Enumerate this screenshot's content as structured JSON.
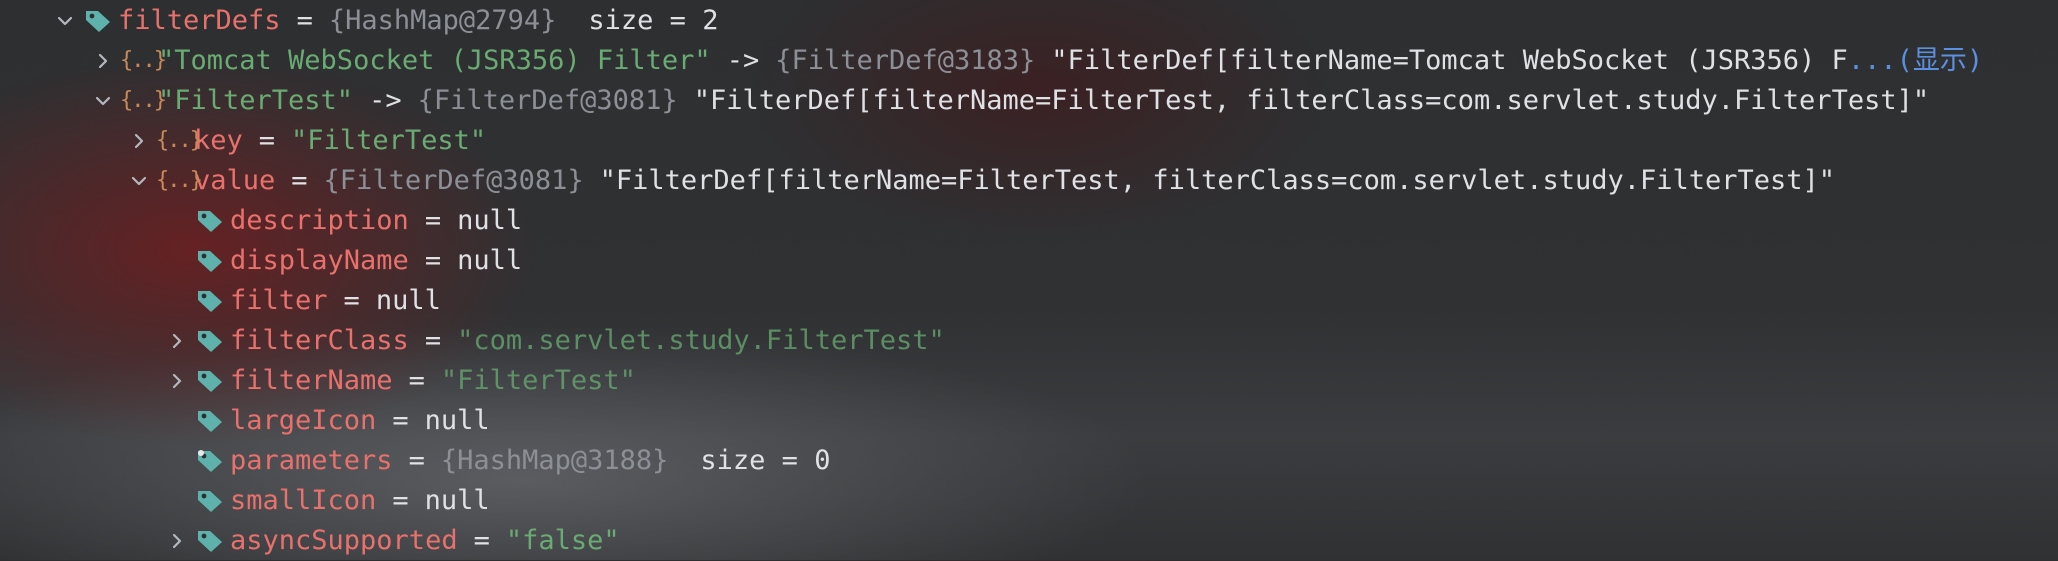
{
  "colors": {
    "field_name": "#e8716d",
    "string_value": "#6aab73",
    "object_ref": "#8c9096",
    "plain_text": "#dfe1e5",
    "tag_icon": "#5fb2ac",
    "object_icon": "#c68a58",
    "link": "#5b8fe0"
  },
  "rows": [
    {
      "name": "filterDefs",
      "eq": "=",
      "ref": "{HashMap@2794}",
      "extra": "size = 2",
      "icon": "tag-icon",
      "chevron": "expanded"
    },
    {
      "key": "\"Tomcat WebSocket (JSR356) Filter\"",
      "arrow": "->",
      "ref": "{FilterDef@3183}",
      "text": "\"FilterDef[filterName=Tomcat WebSocket (JSR356) F",
      "more": "...(显示)",
      "icon": "object-icon",
      "chevron": "collapsed"
    },
    {
      "key": "\"FilterTest\"",
      "arrow": "->",
      "ref": "{FilterDef@3081}",
      "text": "\"FilterDef[filterName=FilterTest, filterClass=com.servlet.study.FilterTest]\"",
      "icon": "object-icon",
      "chevron": "expanded"
    },
    {
      "name": "key",
      "eq": "=",
      "value": "\"FilterTest\"",
      "icon": "object-icon",
      "chevron": "collapsed"
    },
    {
      "name": "value",
      "eq": "=",
      "ref": "{FilterDef@3081}",
      "text": "\"FilterDef[filterName=FilterTest, filterClass=com.servlet.study.FilterTest]\"",
      "icon": "object-icon",
      "chevron": "expanded"
    },
    {
      "name": "description",
      "eq": "=",
      "value": "null",
      "icon": "tag-icon",
      "chevron": "none"
    },
    {
      "name": "displayName",
      "eq": "=",
      "value": "null",
      "icon": "tag-icon",
      "chevron": "none"
    },
    {
      "name": "filter",
      "eq": "=",
      "value": "null",
      "icon": "tag-icon",
      "chevron": "none"
    },
    {
      "name": "filterClass",
      "eq": "=",
      "value": "\"com.servlet.study.FilterTest\"",
      "icon": "tag-icon",
      "chevron": "collapsed"
    },
    {
      "name": "filterName",
      "eq": "=",
      "value": "\"FilterTest\"",
      "icon": "tag-icon",
      "chevron": "collapsed"
    },
    {
      "name": "largeIcon",
      "eq": "=",
      "value": "null",
      "icon": "tag-icon",
      "chevron": "none"
    },
    {
      "name": "parameters",
      "eq": "=",
      "ref": "{HashMap@3188}",
      "extra": "size = 0",
      "icon": "tag-icon",
      "chevron": "none"
    },
    {
      "name": "smallIcon",
      "eq": "=",
      "value": "null",
      "icon": "tag-icon",
      "chevron": "none"
    },
    {
      "name": "asyncSupported",
      "eq": "=",
      "value": "\"false\"",
      "icon": "tag-icon",
      "chevron": "collapsed"
    }
  ]
}
